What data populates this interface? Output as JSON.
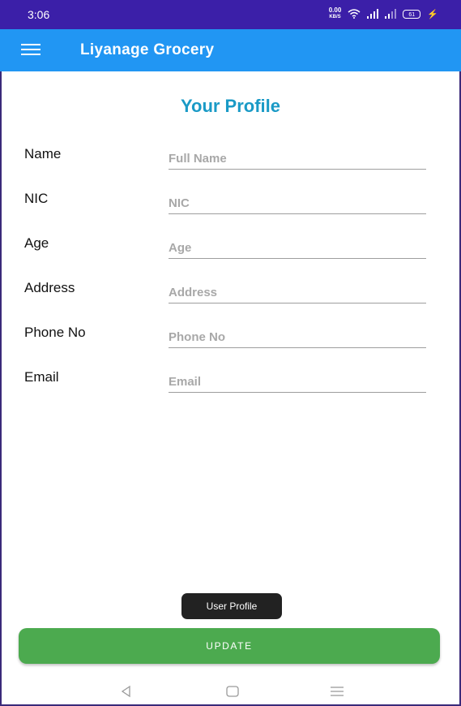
{
  "status_bar": {
    "time": "3:06",
    "speed_value": "0.00",
    "speed_unit": "KB/S",
    "battery": "61"
  },
  "app_bar": {
    "title": "Liyanage Grocery",
    "menu_icon": "hamburger-menu-icon"
  },
  "page": {
    "title": "Your Profile"
  },
  "form": {
    "fields": [
      {
        "label": "Name",
        "placeholder": "Full Name",
        "value": ""
      },
      {
        "label": "NIC",
        "placeholder": "NIC",
        "value": ""
      },
      {
        "label": "Age",
        "placeholder": "Age",
        "value": ""
      },
      {
        "label": "Address",
        "placeholder": "Address",
        "value": ""
      },
      {
        "label": "Phone No",
        "placeholder": "Phone No",
        "value": ""
      },
      {
        "label": "Email",
        "placeholder": "Email",
        "value": ""
      }
    ]
  },
  "toast": {
    "text": "User Profile"
  },
  "actions": {
    "update_label": "UPDATE"
  },
  "colors": {
    "status_bar": "#3b1fa8",
    "app_bar": "#2196f3",
    "title": "#1a9ac6",
    "update_button": "#4caa4f"
  },
  "nav_bar": {
    "icons": [
      "back-icon",
      "home-icon",
      "recent-apps-icon"
    ]
  }
}
